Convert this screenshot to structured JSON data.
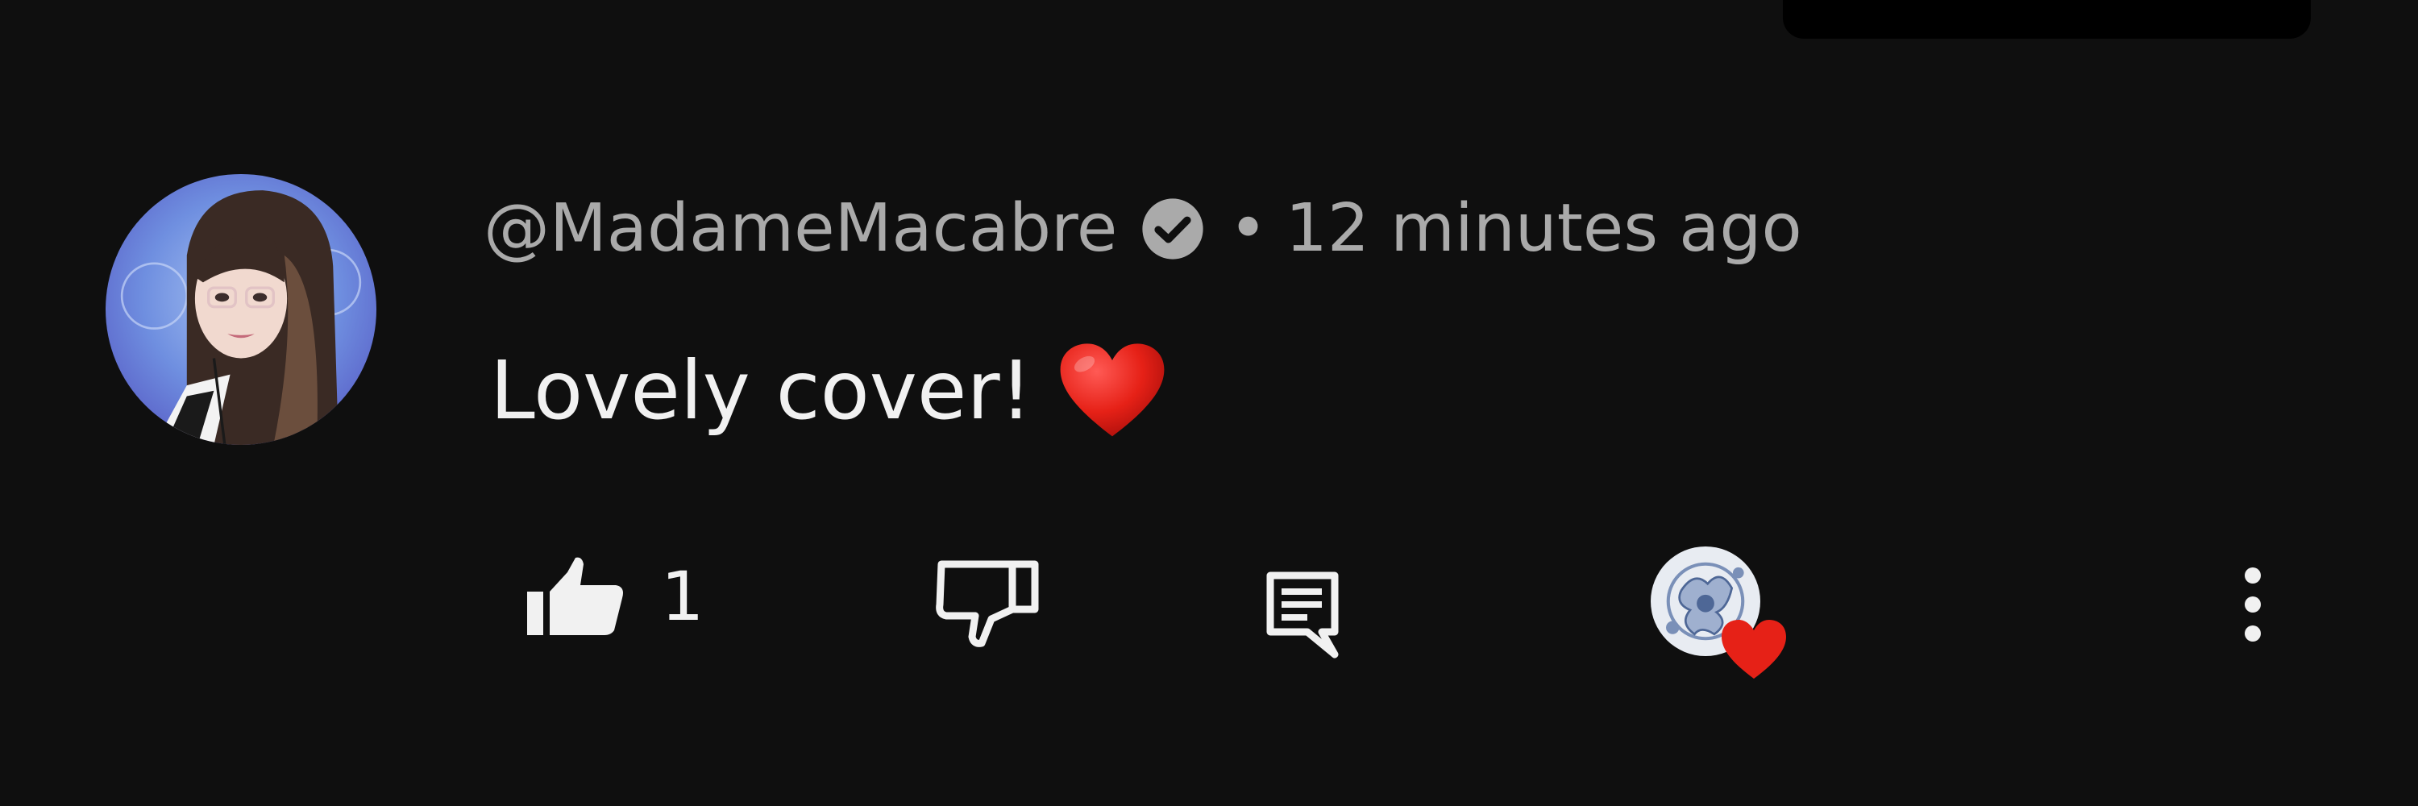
{
  "comment": {
    "handle": "@MadameMacabre",
    "separator": "•",
    "timestamp": "12 minutes ago",
    "text": "Lovely cover!",
    "emoji": "red-heart-emoji",
    "verified_icon": "verified-check-icon"
  },
  "actions": {
    "like_icon": "thumbs-up-icon",
    "like_count": "1",
    "dislike_icon": "thumbs-down-icon",
    "reply_icon": "reply-comment-icon",
    "creator_heart": "creator-heart-icon",
    "more_icon": "more-vertical-icon"
  },
  "colors": {
    "background": "#0f0f0f",
    "handle_text": "#aaaaaa",
    "comment_text": "#f1f1f1",
    "heart": "#e62117"
  }
}
